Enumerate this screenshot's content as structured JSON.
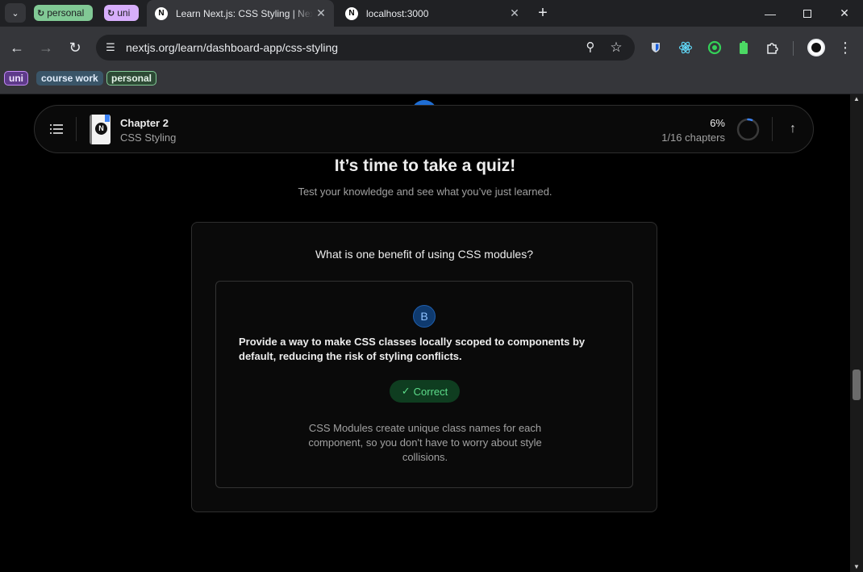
{
  "browser": {
    "tab_groups": [
      {
        "label": "personal",
        "color": "#81c995"
      },
      {
        "label": "uni",
        "color": "#d7aefb"
      }
    ],
    "tabs": [
      {
        "title": "Learn Next.js: CSS Styling | Next.js",
        "favicon": "N",
        "active": true
      },
      {
        "title": "localhost:3000",
        "favicon": "N",
        "active": false
      }
    ],
    "address": {
      "url": "nextjs.org/learn/dashboard-app/css-styling"
    },
    "bookmarks": [
      {
        "label": "uni",
        "color": "#c58af9"
      },
      {
        "label": "course work",
        "color": "#3a5568"
      },
      {
        "label": "personal",
        "color": "#81c995"
      }
    ],
    "icons": {
      "back": "arrow-left-icon",
      "forward": "arrow-right-icon",
      "reload": "reload-icon",
      "site_info": "tune-icon",
      "zoom": "zoom-icon",
      "bookmark": "star-icon",
      "extensions": [
        "bitwarden-icon",
        "react-devtools-icon",
        "green-ring-extension-icon",
        "battery-extension-icon",
        "puzzle-icon"
      ],
      "menu": "more-vertical-icon"
    }
  },
  "course_bar": {
    "chapter_label": "Chapter 2",
    "chapter_name": "CSS Styling",
    "progress_percent": "6%",
    "progress_chapters": "1/16 chapters",
    "progress_value": 0.06,
    "accent": "#3b82f6"
  },
  "quiz": {
    "title": "It’s time to take a quiz!",
    "subtitle": "Test your knowledge and see what you’ve just learned.",
    "question": "What is one benefit of using CSS modules?",
    "selected_option": "B",
    "answer": "Provide a way to make CSS classes locally scoped to components by default, reducing the risk of styling conflicts.",
    "result": "Correct",
    "explanation": "CSS Modules create unique class names for each component, so you don't have to worry about style collisions.",
    "colors": {
      "correct_text": "#5ddc8a",
      "correct_bg": "#0f3d20",
      "option_bg": "#0f3a6e"
    }
  }
}
